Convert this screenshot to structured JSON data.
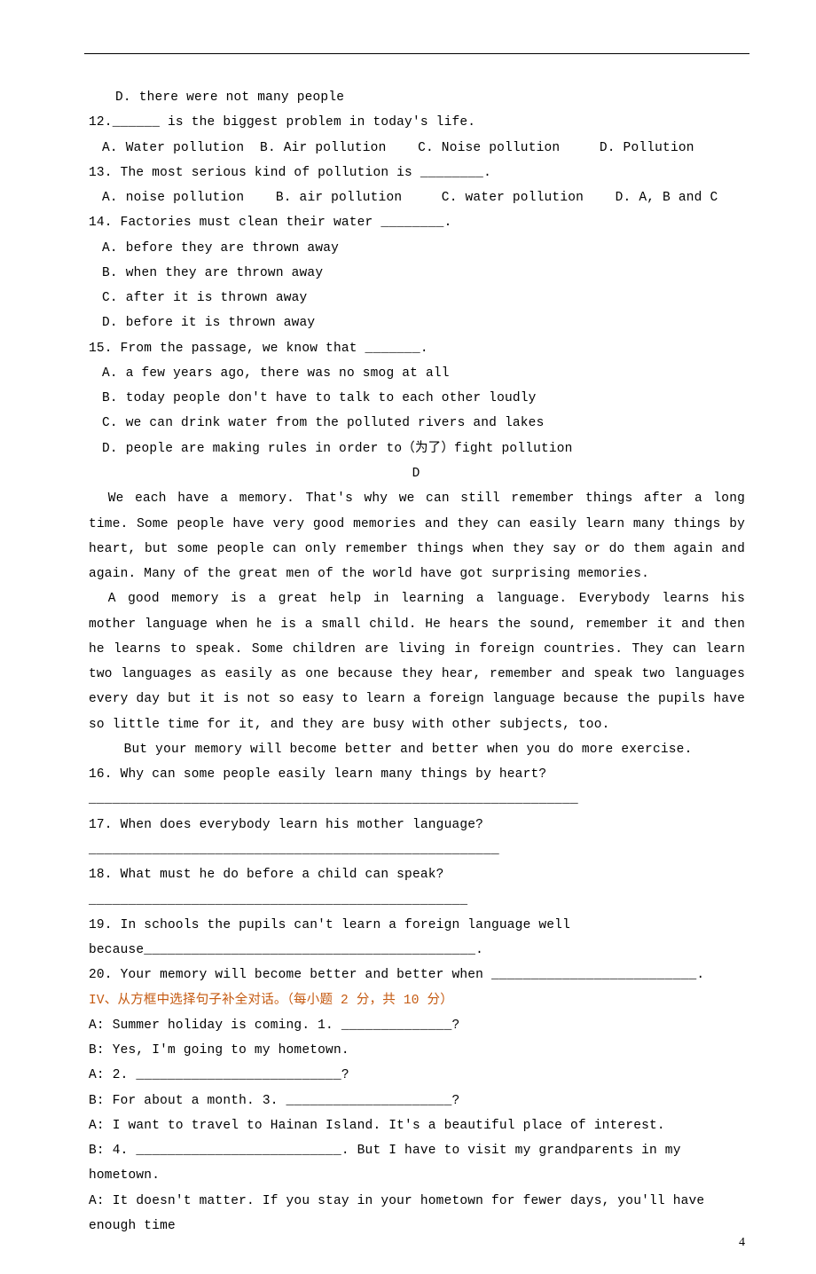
{
  "q11": {
    "D": "D. there were not many people"
  },
  "q12": {
    "stem": "12.______ is the biggest problem in today's life.",
    "A": "A. Water pollution",
    "B": "B. Air pollution",
    "C": "C. Noise pollution",
    "D": "D. Pollution"
  },
  "q13": {
    "stem": "13. The most serious kind of pollution is ________.",
    "A": "A. noise pollution",
    "B": "B. air pollution",
    "C": "C. water pollution",
    "D": "D. A, B and C"
  },
  "q14": {
    "stem": "14. Factories must clean their water ________.",
    "A": "A. before they are thrown away",
    "B": "B. when they are thrown away",
    "C": "C. after it is thrown away",
    "D": "D. before it is thrown away"
  },
  "q15": {
    "stem": "15. From the passage, we know that _______.",
    "A": "A. a few years ago, there was no smog at all",
    "B": "B. today people don't have to talk to each other loudly",
    "C": "C. we can drink water from the polluted rivers and lakes",
    "D": "D. people are making rules in order to（为了）fight pollution"
  },
  "sectionD": {
    "label": "D",
    "p1": "We each have a memory. That's why we can still remember things after a long time. Some people have very good memories and they can easily learn many things by heart, but some people can only remember things when they say or do them again and again. Many of the great men of the world have got surprising memories.",
    "p2": "A good memory is a great help in learning a language. Everybody learns his mother language when he is a small child. He hears the sound, remember it and then he learns to speak. Some children are living in foreign countries. They can learn two languages as easily as one because they hear, remember and speak two languages every day but it is not so easy to learn a foreign language because the pupils have so little time for it, and they are busy with other subjects, too.",
    "p3": "But your memory will become better and better when you do more exercise.",
    "q16": "16. Why can some people easily learn many things by heart?",
    "blank16": "______________________________________________________________",
    "q17": "17. When does everybody learn his mother language?",
    "blank17": "____________________________________________________",
    "q18": "18. What must he do before a child can speak?",
    "blank18": "________________________________________________",
    "q19a": "19. In schools the pupils can't learn a foreign language well",
    "q19b": "because__________________________________________.",
    "q20": "20. Your memory will become better and better when __________________________."
  },
  "sectionIV": {
    "title": "IV、从方框中选择句子补全对话。（每小题 2 分，共 10 分）",
    "lines": [
      "A: Summer holiday is coming. 1. ______________?",
      "B: Yes, I'm going to my hometown.",
      "A: 2. __________________________?",
      "B: For about a month. 3. _____________________?",
      "A: I want to travel to Hainan Island. It's a beautiful place of interest.",
      "B: 4. __________________________. But I have to visit my grandparents in my hometown.",
      "A: It doesn't matter. If you stay in your hometown for fewer days, you'll have enough time"
    ]
  },
  "pageNumber": "4"
}
